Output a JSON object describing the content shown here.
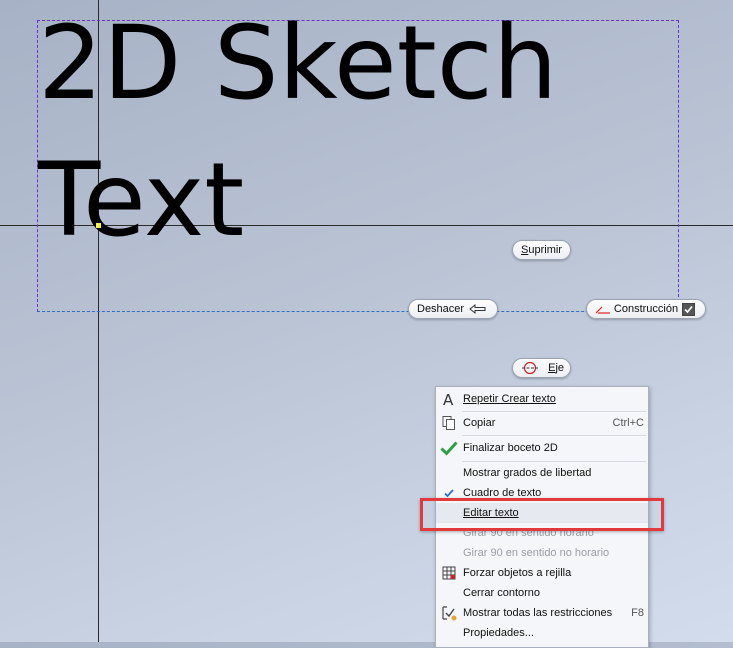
{
  "sketch": {
    "text_line1": "2D Sketch",
    "text_line2": "Text"
  },
  "buttons": {
    "suprimir": "Suprimir",
    "deshacer": "Deshacer",
    "construccion": "Construcción",
    "eje": "Eje"
  },
  "menu": {
    "items": [
      {
        "label": "Repetir Crear texto",
        "shortcut": "",
        "icon": "text-a-icon"
      },
      {
        "label": "Copiar",
        "shortcut": "Ctrl+C",
        "icon": "copy-icon"
      },
      {
        "label": "Finalizar boceto 2D",
        "shortcut": "",
        "icon": "checkmark-icon"
      },
      {
        "label": "Mostrar grados de libertad",
        "shortcut": "",
        "icon": ""
      },
      {
        "label": "Cuadro de texto",
        "shortcut": "",
        "icon": "check-icon"
      },
      {
        "label": "Editar texto",
        "shortcut": "",
        "icon": ""
      },
      {
        "label": "Girar 90 en sentido horario",
        "shortcut": "",
        "icon": ""
      },
      {
        "label": "Girar 90 en sentido no horario",
        "shortcut": "",
        "icon": ""
      },
      {
        "label": "Forzar objetos a rejilla",
        "shortcut": "",
        "icon": "grid-icon"
      },
      {
        "label": "Cerrar contorno",
        "shortcut": "",
        "icon": ""
      },
      {
        "label": "Mostrar todas las restricciones",
        "shortcut": "F8",
        "icon": "constraints-icon"
      },
      {
        "label": "Propiedades...",
        "shortcut": "",
        "icon": ""
      }
    ]
  },
  "colors": {
    "highlight_box": "#e23a3a",
    "text_box_border": "#6a2fd6",
    "check_green": "#2ea043"
  }
}
